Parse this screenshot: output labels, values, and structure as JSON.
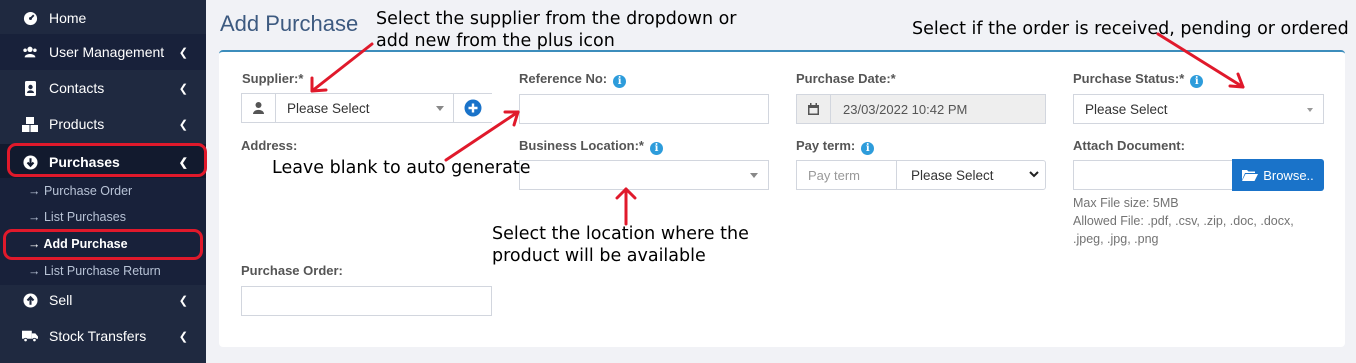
{
  "sidebar": {
    "items": [
      {
        "label": "Home",
        "icon": "dashboard-icon"
      },
      {
        "label": "User Management",
        "icon": "users-icon"
      },
      {
        "label": "Contacts",
        "icon": "address-book-icon"
      },
      {
        "label": "Products",
        "icon": "cubes-icon"
      },
      {
        "label": "Purchases",
        "icon": "arrow-circle-down-icon"
      },
      {
        "label": "Sell",
        "icon": "arrow-circle-up-icon"
      },
      {
        "label": "Stock Transfers",
        "icon": "truck-icon"
      }
    ],
    "purchases_sub": [
      {
        "label": "→ Purchase Order"
      },
      {
        "label": "→ List Purchases"
      },
      {
        "label": "→ Add Purchase"
      },
      {
        "label": "→ List Purchase Return"
      }
    ]
  },
  "page": {
    "title": "Add Purchase"
  },
  "form": {
    "supplier": {
      "label": "Supplier:*",
      "value": "Please Select"
    },
    "reference": {
      "label": "Reference No:",
      "value": ""
    },
    "purchase_date": {
      "label": "Purchase Date:*",
      "value": "23/03/2022 10:42 PM"
    },
    "purchase_status": {
      "label": "Purchase Status:*",
      "value": "Please Select"
    },
    "address": {
      "label": "Address:"
    },
    "business_location": {
      "label": "Business Location:*",
      "value": ""
    },
    "pay_term": {
      "label": "Pay term:",
      "placeholder": "Pay term",
      "unit_value": "Please Select"
    },
    "attach_document": {
      "label": "Attach Document:",
      "browse_label": "Browse..",
      "help_size": "Max File size: 5MB",
      "help_allowed_1": "Allowed File: .pdf, .csv, .zip, .doc, .docx,",
      "help_allowed_2": ".jpeg, .jpg, .png"
    },
    "purchase_order": {
      "label": "Purchase Order:",
      "value": ""
    }
  },
  "annotations": {
    "supplier_1": "Select the supplier from the dropdown or",
    "supplier_2": "add new from the plus icon",
    "status": "Select if the order is received, pending or ordered",
    "reference": "Leave blank to auto generate",
    "location_1": "Select the location where the",
    "location_2": "product will be available"
  },
  "colors": {
    "sidebar_bg": "#1f2940",
    "accent_blue": "#3c8dbc",
    "annotation_red": "#e0192b",
    "browse_button": "#1a73c9"
  }
}
